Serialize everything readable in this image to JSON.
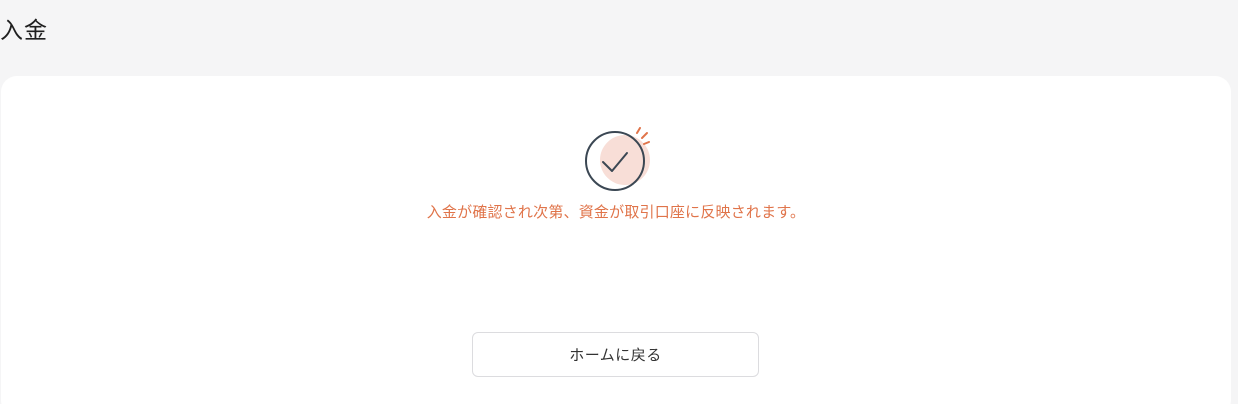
{
  "page": {
    "title": "入金"
  },
  "status": {
    "icon": "check-circle-icon",
    "message": "入金が確認され次第、資金が取引口座に反映されます。"
  },
  "actions": {
    "home_label": "ホームに戻る"
  },
  "colors": {
    "accent": "#e0744a",
    "icon_stroke": "#3b4753",
    "icon_fill": "#f8ded7",
    "background": "#f5f5f6",
    "card": "#ffffff"
  }
}
